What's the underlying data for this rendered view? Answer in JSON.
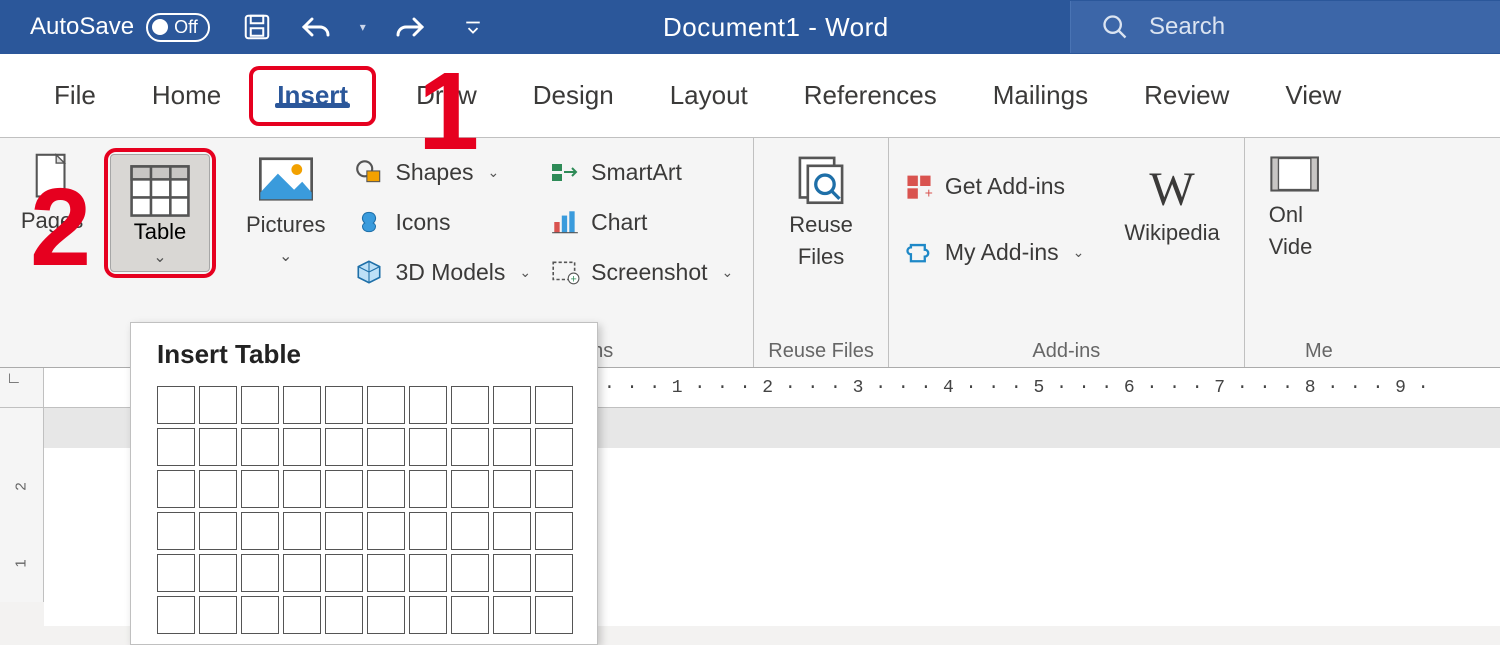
{
  "titlebar": {
    "autosave_label": "AutoSave",
    "autosave_state": "Off",
    "document_title": "Document1  -  Word",
    "search_placeholder": "Search"
  },
  "tabs": {
    "file": "File",
    "home": "Home",
    "insert": "Insert",
    "draw": "Draw",
    "design": "Design",
    "layout": "Layout",
    "references": "References",
    "mailings": "Mailings",
    "review": "Review",
    "view": "View"
  },
  "ribbon": {
    "pages_label": "Pages",
    "table_label": "Table",
    "pictures_label": "Pictures",
    "shapes_label": "Shapes",
    "icons_label": "Icons",
    "models_label": "3D Models",
    "smartart_label": "SmartArt",
    "chart_label": "Chart",
    "screenshot_label": "Screenshot",
    "illustrations_group_suffix": "ons",
    "reuse_label_1": "Reuse",
    "reuse_label_2": "Files",
    "reuse_group": "Reuse Files",
    "get_addins": "Get Add-ins",
    "my_addins": "My Add-ins",
    "addins_group": "Add-ins",
    "wikipedia": "Wikipedia",
    "online_1": "Onl",
    "online_2": "Vide",
    "media_group_cut": "Me"
  },
  "dropdown": {
    "title": "Insert Table"
  },
  "ruler": {
    "text": "· · · 1 · · · 2 · · · 3 · · · 4 · · · 5 · · · 6 · · · 7 · · · 8 · · · 9 · ",
    "v1": "2",
    "v2": "1"
  },
  "annotations": {
    "one": "1",
    "two": "2"
  }
}
